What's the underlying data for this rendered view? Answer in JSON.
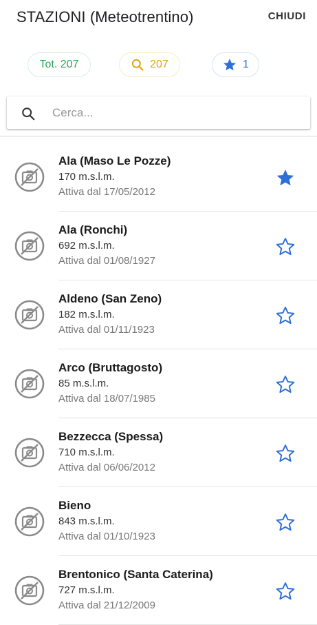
{
  "header": {
    "title": "STAZIONI (Meteotrentino)",
    "close_label": "CHIUDI"
  },
  "chips": {
    "total": "Tot. 207",
    "search_count": "207",
    "favorites_count": "1",
    "colors": {
      "total": "#2fa35a",
      "search": "#e1a50f",
      "favorites": "#2f6fd8"
    }
  },
  "search": {
    "placeholder": "Cerca...",
    "value": ""
  },
  "stations": [
    {
      "name": "Ala (Maso Le Pozze)",
      "altitude": "170 m.s.l.m.",
      "since": "Attiva dal 17/05/2012",
      "favorite": true
    },
    {
      "name": "Ala (Ronchi)",
      "altitude": "692 m.s.l.m.",
      "since": "Attiva dal 01/08/1927",
      "favorite": false
    },
    {
      "name": "Aldeno (San Zeno)",
      "altitude": "182 m.s.l.m.",
      "since": "Attiva dal 01/11/1923",
      "favorite": false
    },
    {
      "name": "Arco (Bruttagosto)",
      "altitude": "85 m.s.l.m.",
      "since": "Attiva dal 18/07/1985",
      "favorite": false
    },
    {
      "name": "Bezzecca (Spessa)",
      "altitude": "710 m.s.l.m.",
      "since": "Attiva dal 06/06/2012",
      "favorite": false
    },
    {
      "name": "Bieno",
      "altitude": "843 m.s.l.m.",
      "since": "Attiva dal 01/10/1923",
      "favorite": false
    },
    {
      "name": "Brentonico (Santa Caterina)",
      "altitude": "727 m.s.l.m.",
      "since": "Attiva dal 21/12/2009",
      "favorite": false
    }
  ]
}
